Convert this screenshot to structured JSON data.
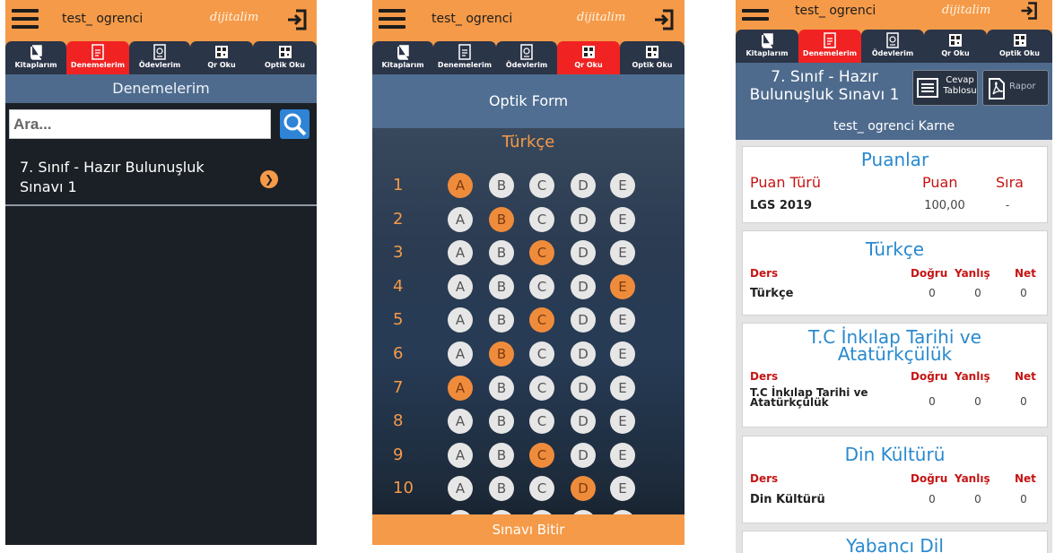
{
  "app": {
    "user": "test_ ogrenci",
    "brand": "dijitalim"
  },
  "tabs": [
    "Kitaplarım",
    "Denemelerim",
    "Ödevlerim",
    "Qr Oku",
    "Optik Oku"
  ],
  "colors": {
    "accent": "#f59a48",
    "active_tab": "#f02222",
    "tab": "#2b3548",
    "titlebar": "#4e6b8d",
    "card_title": "#2889cf",
    "card_header": "#c51414"
  },
  "screen1": {
    "title": "Denemelerim",
    "search_placeholder": "Ara...",
    "item": "7. Sınıf - Hazır Bulunuşluk Sınavı 1"
  },
  "screen2": {
    "title": "Optik Form",
    "section": "Türkçe",
    "options": [
      "A",
      "B",
      "C",
      "D",
      "E"
    ],
    "questions": [
      {
        "n": "1",
        "selected": "A"
      },
      {
        "n": "2",
        "selected": "B"
      },
      {
        "n": "3",
        "selected": "C"
      },
      {
        "n": "4",
        "selected": "E"
      },
      {
        "n": "5",
        "selected": "C"
      },
      {
        "n": "6",
        "selected": "B"
      },
      {
        "n": "7",
        "selected": "A"
      },
      {
        "n": "8",
        "selected": ""
      },
      {
        "n": "9",
        "selected": "C"
      },
      {
        "n": "10",
        "selected": "D"
      }
    ],
    "finish": "Sınavı Bitir"
  },
  "screen3": {
    "exam_title": "7. Sınıf - Hazır Bulunuşluk Sınavı 1",
    "answer_key_label": "Cevap Tablosu",
    "report_label": "Rapor",
    "karne_title": "test_ ogrenci Karne",
    "puanlar": {
      "title": "Puanlar",
      "headers": [
        "Puan Türü",
        "Puan",
        "Sıra"
      ],
      "row": [
        "LGS 2019",
        "100,00",
        "-"
      ]
    },
    "subject_headers": [
      "Ders",
      "Doğru",
      "Yanlış",
      "Net"
    ],
    "subjects": [
      {
        "title": "Türkçe",
        "name": "Türkçe",
        "dogru": "0",
        "yanlis": "0",
        "net": "0"
      },
      {
        "title": "T.C İnkılap Tarihi ve Atatürkçülük",
        "name": "T.C İnkılap Tarihi ve Atatürkçülük",
        "dogru": "0",
        "yanlis": "0",
        "net": "0"
      },
      {
        "title": "Din Kültürü",
        "name": "Din Kültürü",
        "dogru": "0",
        "yanlis": "0",
        "net": "0"
      },
      {
        "title": "Yabancı Dil"
      }
    ]
  }
}
